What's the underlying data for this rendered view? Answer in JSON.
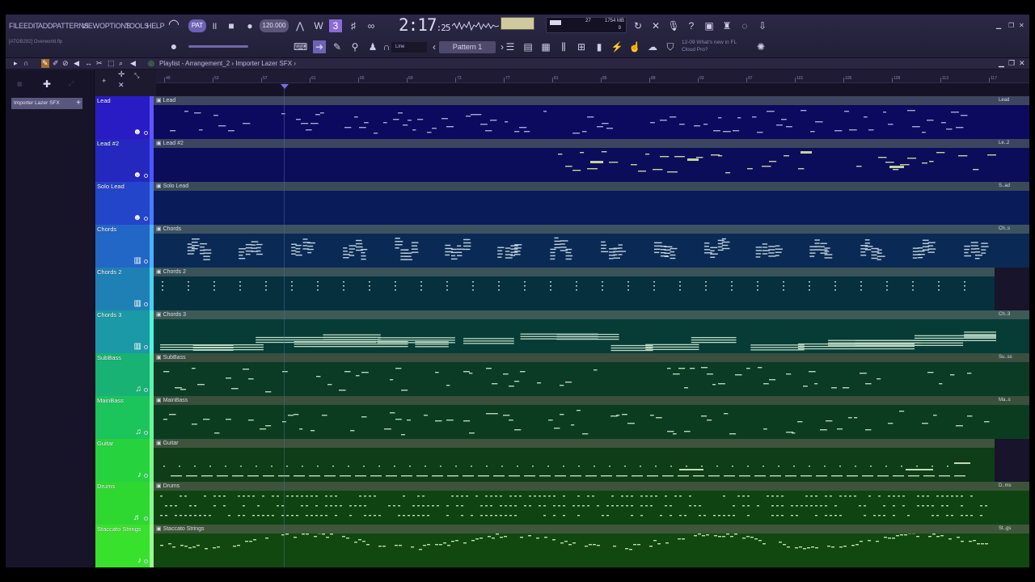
{
  "menu": [
    "FILE",
    "EDIT",
    "ADD",
    "PATTERNS",
    "VIEW",
    "OPTIONS",
    "TOOLS",
    "HELP"
  ],
  "project_file": "[ATOB292] Overworld.flp",
  "transport": {
    "tempo": "120.000",
    "mode": "PAT",
    "time_main": "2:17",
    "time_sub": ":25"
  },
  "monitor": {
    "ram": "1754 MB",
    "cpu_a": "27",
    "cpu_b": "9"
  },
  "pattern_selector": "Pattern 1",
  "snap_selector": "Line",
  "news": {
    "line1": "12-09  What's new in FL",
    "line2": "Cloud Pro?"
  },
  "playlist": {
    "breadcrumb": "Playlist - Arrangement_2 › Importer Lazer SFX ›"
  },
  "browser": {
    "pattern_item": "Importer Lazer SFX"
  },
  "ruler_numbers": [
    "49",
    "53",
    "57",
    "61",
    "65",
    "69",
    "73",
    "77",
    "81",
    "85",
    "89",
    "93",
    "97",
    "101",
    "105",
    "109",
    "113",
    "117"
  ],
  "tracks": [
    {
      "name": "Lead",
      "clip": "Lead",
      "end": "Lead",
      "icon": "☻",
      "hdr": "#2a1cc4",
      "strip": "#6255ff",
      "bar": "#3e4560",
      "body": "#0c0a5e",
      "note": "#9ea9d6",
      "pattern": "melody",
      "full": true
    },
    {
      "name": "Lead #2",
      "clip": "Lead #2",
      "end": "Le..2",
      "icon": "☻",
      "hdr": "#2528bf",
      "strip": "#4d55ff",
      "bar": "#3c4560",
      "body": "#0c0d5a",
      "note": "#c6d2a0",
      "pattern": "sparse-late",
      "full": true
    },
    {
      "name": "Solo Lead",
      "clip": "Solo Lead",
      "end": "S..ad",
      "icon": "☻",
      "hdr": "#2345c9",
      "strip": "#4a7bff",
      "bar": "#3a4a5a",
      "body": "#0a1b5a",
      "note": "#9eb2d6",
      "pattern": "empty",
      "full": true
    },
    {
      "name": "Chords",
      "clip": "Chords",
      "end": "Ch..s",
      "icon": "▥",
      "hdr": "#2266c6",
      "strip": "#49b2ff",
      "bar": "#3d5260",
      "body": "#0a2a55",
      "note": "#bfd0dc",
      "pattern": "chords",
      "full": true
    },
    {
      "name": "Chords 2",
      "clip": "Chords 2",
      "end": "",
      "icon": "▥",
      "hdr": "#1f80b6",
      "strip": "#4ad0ee",
      "bar": "#3a5358",
      "body": "#06303e",
      "note": "#c4d6d8",
      "pattern": "dots",
      "full": false
    },
    {
      "name": "Chords 3",
      "clip": "Chords 3",
      "end": "Ch..3",
      "icon": "▥",
      "hdr": "#1b99a6",
      "strip": "#52f2dd",
      "bar": "#3e5a56",
      "body": "#073b36",
      "note": "#bfdcc6",
      "pattern": "pads",
      "full": true
    },
    {
      "name": "SubBass",
      "clip": "SubBass",
      "end": "Su..ss",
      "icon": "♫",
      "hdr": "#17b274",
      "strip": "#60f0b0",
      "bar": "#3a4f40",
      "body": "#0b3a25",
      "note": "#b6d8bc",
      "pattern": "bass",
      "full": true
    },
    {
      "name": "MainBass",
      "clip": "MainBass",
      "end": "Ma..s",
      "icon": "♫",
      "hdr": "#1cc45c",
      "strip": "#6af59a",
      "bar": "#3a4f3c",
      "body": "#0c3c20",
      "note": "#b4d8b4",
      "pattern": "bass",
      "full": true
    },
    {
      "name": "Guitar",
      "clip": "Guitar",
      "end": "",
      "icon": "♪",
      "hdr": "#26d23e",
      "strip": "#7bf58a",
      "bar": "#3e533c",
      "body": "#0e3d17",
      "note": "#c2dbb4",
      "pattern": "guitar",
      "full": false
    },
    {
      "name": "Drums",
      "clip": "Drums",
      "end": "D..ms",
      "icon": "♬",
      "hdr": "#2fd831",
      "strip": "#8bf590",
      "bar": "#3d533b",
      "body": "#0f4412",
      "note": "#b8ddb0",
      "pattern": "drums",
      "full": true
    },
    {
      "name": "Staccato Strings",
      "clip": "Staccato Strings",
      "end": "St..gs",
      "icon": "♪",
      "hdr": "#38e12c",
      "strip": "#9bf892",
      "bar": "#3f563a",
      "body": "#11480f",
      "note": "#b8e0a8",
      "pattern": "strings",
      "full": true
    }
  ]
}
